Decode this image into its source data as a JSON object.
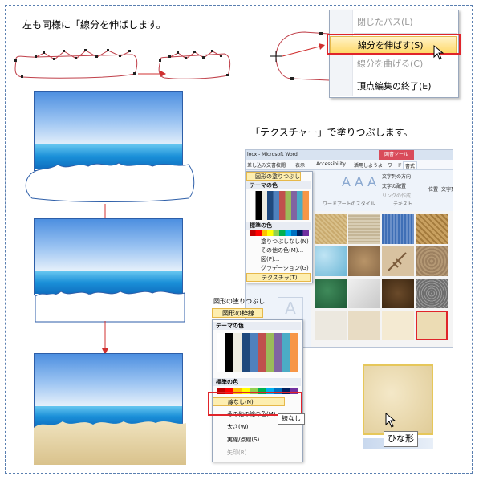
{
  "caption_top": "左も同様に「線分を伸ばします。",
  "caption_texture": "「テクスチャー」で塗りつぶします。",
  "context_menu": {
    "items": [
      {
        "label": "閉じたパス(L)",
        "enabled": false
      },
      {
        "label": "線分を伸ばす(S)",
        "enabled": true,
        "highlighted": true
      },
      {
        "label": "線分を曲げる(C)",
        "enabled": false
      },
      {
        "label": "頂点編集の終了(E)",
        "enabled": true
      }
    ]
  },
  "ribbon": {
    "title": "locx - Microsoft Word",
    "context_tab": "図書ツール",
    "tabs": [
      "差し込み文書",
      "校閲",
      "表示",
      "Accessibility",
      "活用しようよ！ワード",
      "書式"
    ],
    "text_group": [
      "文字列の方向",
      "文字の配置",
      "リンクの作成"
    ],
    "group_labels": [
      "ワードアートのスタイル",
      "テキスト"
    ],
    "right_buttons": [
      "位置",
      "文字列の折り返し"
    ]
  },
  "fill_menu": {
    "button_label": "図形の塗りつぶし",
    "theme_header": "テーマの色",
    "standard_header": "標準の色",
    "items": [
      "塗りつぶしなし(N)",
      "その他の色(M)...",
      "図(P)...",
      "グラデーション(G)",
      "テクスチャ(T)"
    ],
    "selected": "テクスチャ(T)"
  },
  "outline_menu": {
    "fill_button": "図形の塗りつぶし",
    "outline_button": "図形の枠線",
    "theme_header": "テーマの色",
    "standard_header": "標準の色",
    "items": [
      "線なし(N)",
      "その他の線の色(M)...",
      "太さ(W)",
      "実線/点線(S)",
      "矢印(R)"
    ],
    "highlighted": "線なし(N)",
    "tooltip": "線なし"
  },
  "texture_preview_tooltip": "ひな形",
  "colors": {
    "highlight_red": "#e0242a",
    "frame_blue": "#5a7fb0",
    "menu_highlight": "#ffd96a",
    "sea_blue": "#1a8fd8",
    "sand": "#e6d4a6"
  }
}
